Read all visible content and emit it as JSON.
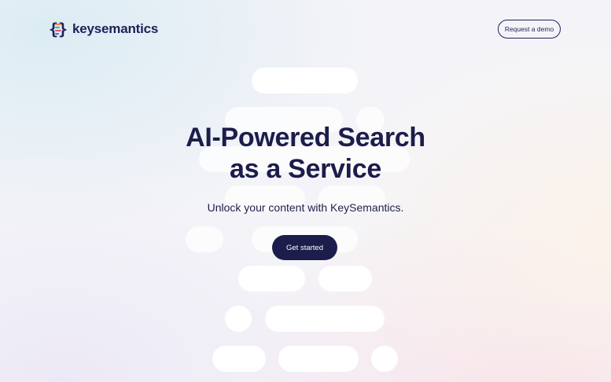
{
  "header": {
    "logo_text": "keysemantics",
    "logo_icon": "brace-key-icon",
    "demo_button_label": "Request a demo"
  },
  "hero": {
    "title_line1": "AI-Powered Search",
    "title_line2": "as a Service",
    "subtitle": "Unlock your content with KeySemantics.",
    "cta_label": "Get started"
  },
  "colors": {
    "brand_navy": "#1c1d4a",
    "logo_accent_orange": "#f08a3c",
    "logo_accent_teal": "#2fb6b0",
    "logo_accent_pink": "#e0527e"
  }
}
